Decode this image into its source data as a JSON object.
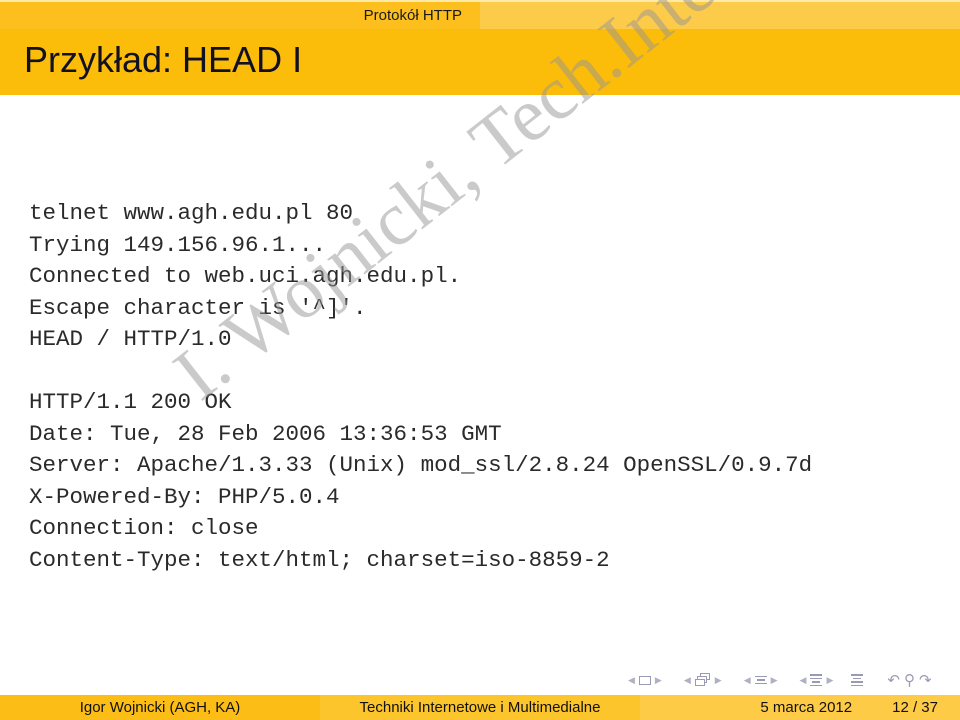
{
  "header": {
    "section": "Protokół HTTP",
    "title": "Przykład: HEAD I"
  },
  "code_lines": [
    "telnet www.agh.edu.pl 80",
    "Trying 149.156.96.1...",
    "Connected to web.uci.agh.edu.pl.",
    "Escape character is '^]'.",
    "HEAD / HTTP/1.0",
    "",
    "HTTP/1.1 200 OK",
    "Date: Tue, 28 Feb 2006 13:36:53 GMT",
    "Server: Apache/1.3.33 (Unix) mod_ssl/2.8.24 OpenSSL/0.9.7d",
    "X-Powered-By: PHP/5.0.4",
    "Connection: close",
    "Content-Type: text/html; charset=iso-8859-2"
  ],
  "watermark": "I. Wojnicki, Tech.Inter.",
  "navigation": {
    "icons": [
      "frame-nav-icon",
      "subsection-nav-icon",
      "section-nav-icon",
      "subsection-list-icon",
      "toc-icon",
      "back-icon",
      "search-icon",
      "forward-icon"
    ],
    "back_glyph": "↶",
    "search_glyph": "⚲",
    "forward_glyph": "↷",
    "left_arrow": "◀",
    "right_arrow": "▶"
  },
  "footer": {
    "author": "Igor Wojnicki  (AGH, KA)",
    "course": "Techniki Internetowe i Multimedialne",
    "date": "5 marca 2012",
    "page": "12 / 37"
  }
}
